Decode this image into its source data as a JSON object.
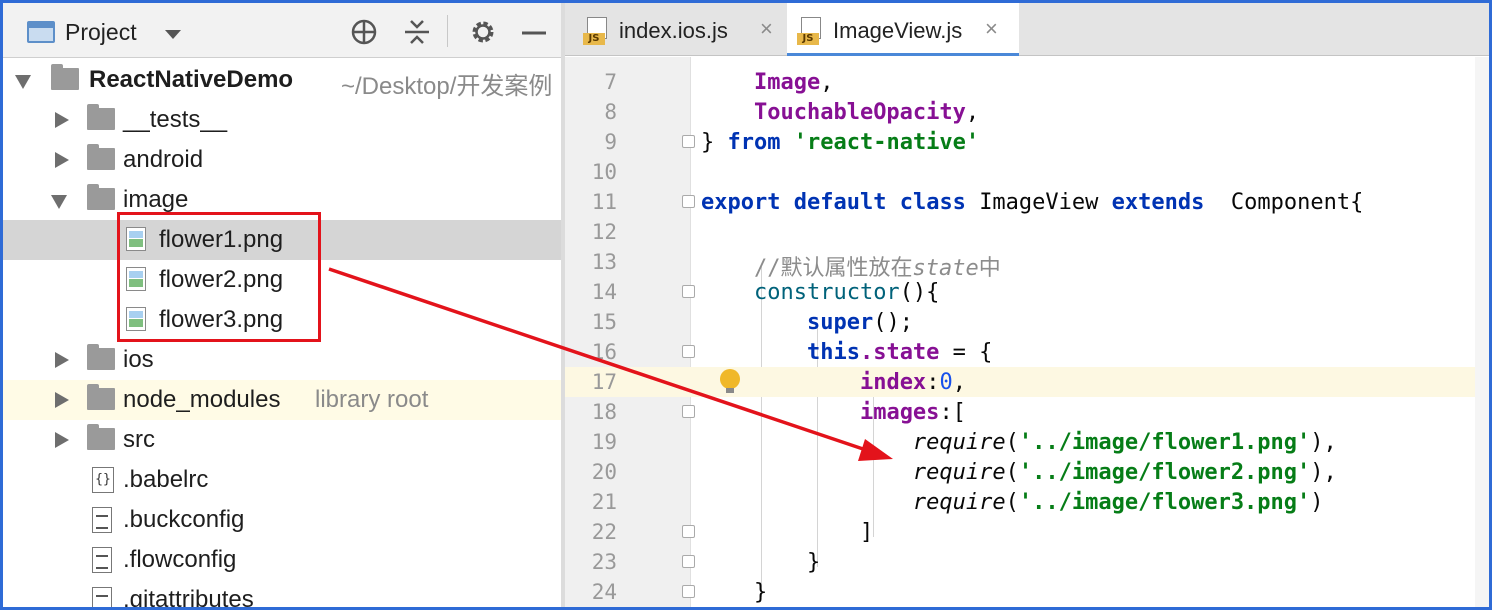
{
  "project_panel": {
    "title": "Project",
    "buttons": [
      "locate-icon",
      "collapse-icon",
      "gear-icon",
      "minimize-icon"
    ],
    "root": {
      "name": "ReactNativeDemo",
      "path": "~/Desktop/开发案例"
    },
    "items": [
      {
        "label": "__tests__",
        "kind": "folder",
        "expanded": false
      },
      {
        "label": "android",
        "kind": "folder",
        "expanded": false
      },
      {
        "label": "image",
        "kind": "folder",
        "expanded": true
      },
      {
        "label": "flower1.png",
        "kind": "png",
        "selected": true
      },
      {
        "label": "flower2.png",
        "kind": "png"
      },
      {
        "label": "flower3.png",
        "kind": "png"
      },
      {
        "label": "ios",
        "kind": "folder",
        "expanded": false
      },
      {
        "label": "node_modules",
        "kind": "folder",
        "expanded": false,
        "suffix": "library root"
      },
      {
        "label": "src",
        "kind": "folder",
        "expanded": false
      },
      {
        "label": ".babelrc",
        "kind": "babel"
      },
      {
        "label": ".buckconfig",
        "kind": "doc"
      },
      {
        "label": ".flowconfig",
        "kind": "doc"
      },
      {
        "label": ".gitattributes",
        "kind": "doc"
      }
    ]
  },
  "editor": {
    "tabs": [
      {
        "label": "index.ios.js",
        "badge": "JS",
        "active": false
      },
      {
        "label": "ImageView.js",
        "badge": "JS",
        "active": true
      }
    ],
    "close_glyph": "×",
    "lines": [
      {
        "n": "7"
      },
      {
        "n": "8"
      },
      {
        "n": "9"
      },
      {
        "n": "10"
      },
      {
        "n": "11"
      },
      {
        "n": "12"
      },
      {
        "n": "13"
      },
      {
        "n": "14"
      },
      {
        "n": "15"
      },
      {
        "n": "16"
      },
      {
        "n": "17",
        "current": true
      },
      {
        "n": "18"
      },
      {
        "n": "19"
      },
      {
        "n": "20"
      },
      {
        "n": "21"
      },
      {
        "n": "22"
      },
      {
        "n": "23"
      },
      {
        "n": "24"
      }
    ],
    "code": {
      "l7": "Image",
      "l8": "TouchableOpacity",
      "l9_from": "from",
      "l9_module": "'react-native'",
      "l11_export": "export",
      "l11_default": "default",
      "l11_class": "class",
      "l11_name": "ImageView",
      "l11_extends": "extends",
      "l11_base": "Component{",
      "l13_comment_a": "//默认属性放在",
      "l13_comment_b": "state",
      "l13_comment_c": "中",
      "l14_ctor": "constructor",
      "l15_super": "super",
      "l16_this": "this",
      "l16_state": ".state",
      "l17_key": "index",
      "l17_val": "0",
      "l18_key": "images",
      "l19_fn": "require",
      "l19_str": "'../image/flower1.png'",
      "l20_str": "'../image/flower2.png'",
      "l21_str": "'../image/flower3.png'"
    }
  },
  "annotation": {
    "color": "#e3131b"
  }
}
